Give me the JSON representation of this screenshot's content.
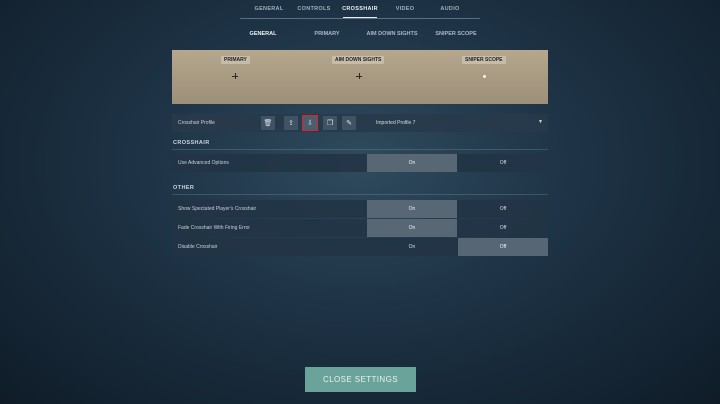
{
  "topnav": {
    "tabs": [
      "GENERAL",
      "CONTROLS",
      "CROSSHAIR",
      "VIDEO",
      "AUDIO"
    ],
    "active": "CROSSHAIR"
  },
  "subnav": {
    "tabs": [
      "GENERAL",
      "PRIMARY",
      "AIM DOWN SIGHTS",
      "SNIPER SCOPE"
    ],
    "active": "GENERAL"
  },
  "preview": {
    "labels": [
      "PRIMARY",
      "AIM DOWN SIGHTS",
      "SNIPER SCOPE"
    ]
  },
  "profile": {
    "label": "Crosshair Profile",
    "selected": "Imported Profile 7",
    "icons": [
      "trash-icon",
      "export-icon",
      "import-icon",
      "copy-icon",
      "rename-icon"
    ]
  },
  "sections": {
    "crosshair_title": "CROSSHAIR",
    "other_title": "OTHER"
  },
  "options": {
    "on": "On",
    "off": "Off"
  },
  "rows": {
    "advanced": {
      "label": "Use Advanced Options",
      "value": "On"
    },
    "spectated": {
      "label": "Show Spectated Player's Crosshair",
      "value": "On"
    },
    "fade": {
      "label": "Fade Crosshair With Firing Error",
      "value": "On"
    },
    "disable": {
      "label": "Disable Crosshair",
      "value": "Off"
    }
  },
  "close_button": "CLOSE SETTINGS",
  "colors": {
    "accent_button": "#6aa39a",
    "highlight_outline": "#e0202a"
  }
}
